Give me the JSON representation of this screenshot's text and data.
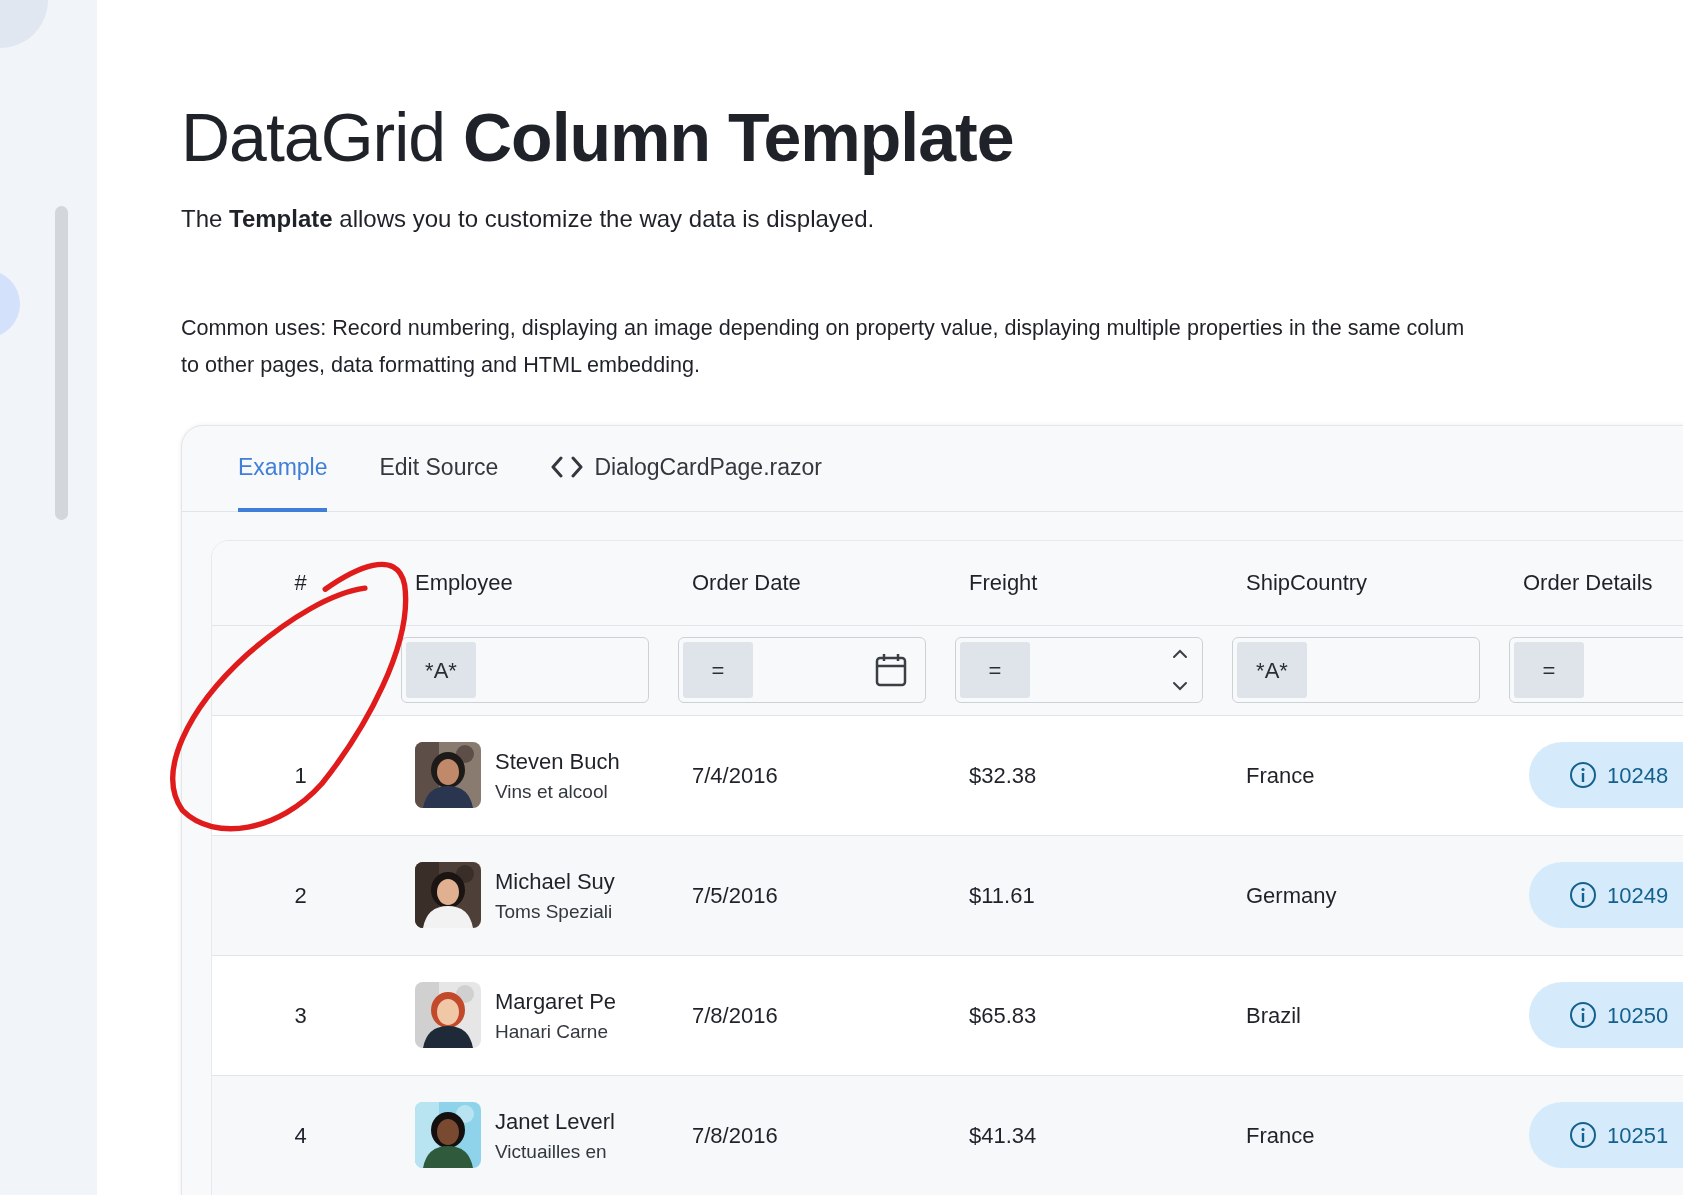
{
  "page": {
    "title": "DataGrid **Column Template**",
    "intro": "The **Template** allows you to customize the way data is displayed.",
    "description_lines": [
      "Common uses: Record numbering, displaying an image depending on property value, displaying multiple properties in the same colum",
      "to other pages, data formatting and HTML embedding."
    ]
  },
  "tabs": [
    {
      "label": "Example",
      "selected": true,
      "kind": "text"
    },
    {
      "label": "Edit Source",
      "selected": false,
      "kind": "text"
    },
    {
      "label": "DialogCardPage.razor",
      "selected": false,
      "kind": "code"
    }
  ],
  "grid": {
    "columns": [
      "#",
      "Employee",
      "Order Date",
      "Freight",
      "ShipCountry",
      "Order Details"
    ],
    "filters": [
      {
        "kind": "none"
      },
      {
        "operator": "*A*",
        "kind": "text"
      },
      {
        "operator": "=",
        "kind": "date"
      },
      {
        "operator": "=",
        "kind": "number"
      },
      {
        "operator": "*A*",
        "kind": "text"
      },
      {
        "operator": "=",
        "kind": "plain"
      }
    ],
    "rows": [
      {
        "number": "1",
        "employee": "Steven Buch",
        "company": "Vins et alcool",
        "order_date": "7/4/2016",
        "freight": "$32.38",
        "ship_country": "France",
        "order_id": "10248"
      },
      {
        "number": "2",
        "employee": "Michael Suy",
        "company": "Toms Speziali",
        "order_date": "7/5/2016",
        "freight": "$11.61",
        "ship_country": "Germany",
        "order_id": "10249"
      },
      {
        "number": "3",
        "employee": "Margaret Pe",
        "company": "Hanari Carne",
        "order_date": "7/8/2016",
        "freight": "$65.83",
        "ship_country": "Brazil",
        "order_id": "10250"
      },
      {
        "number": "4",
        "employee": "Janet Leverl",
        "company": "Victuailles en",
        "order_date": "7/8/2016",
        "freight": "$41.34",
        "ship_country": "France",
        "order_id": "10251"
      }
    ]
  }
}
